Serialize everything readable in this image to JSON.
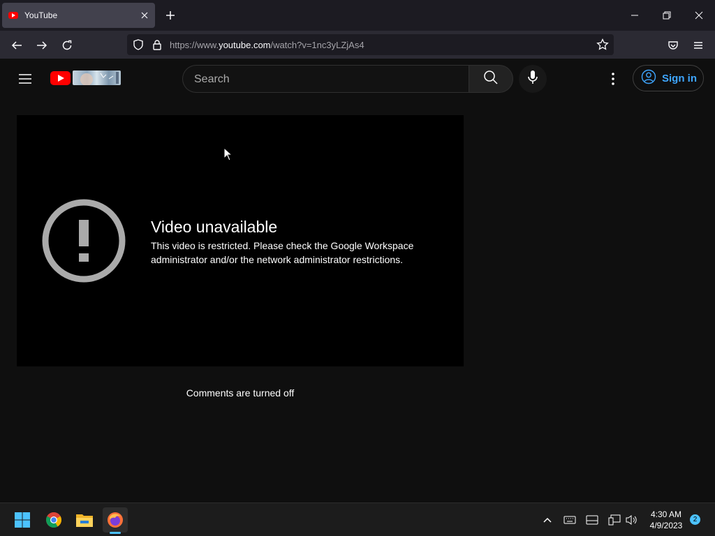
{
  "browser": {
    "tab_title": "YouTube",
    "url_prefix": "https://www.",
    "url_domain": "youtube.com",
    "url_path": "/watch?v=1nc3yLZjAs4"
  },
  "youtube": {
    "search_placeholder": "Search",
    "sign_in_label": "Sign in",
    "error_title": "Video unavailable",
    "error_message": "This video is restricted. Please check the Google Workspace administrator and/or the network administrator restrictions.",
    "comments_status": "Comments are turned off"
  },
  "taskbar": {
    "time": "4:30 AM",
    "date": "4/9/2023",
    "notification_count": "2"
  },
  "colors": {
    "youtube_red": "#ff0000",
    "link_blue": "#3ea6ff",
    "accent": "#4cc2ff"
  }
}
